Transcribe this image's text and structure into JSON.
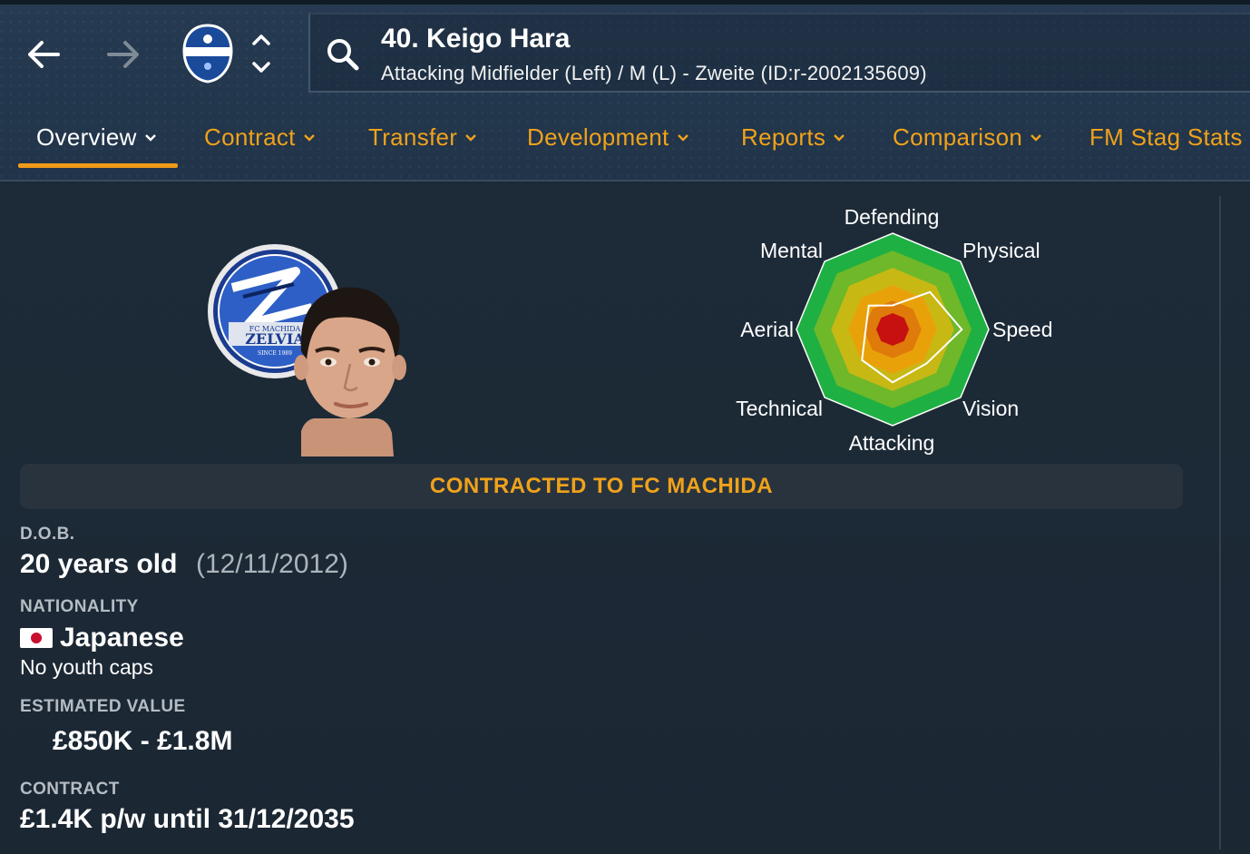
{
  "header": {
    "player_title": "40. Keigo Hara",
    "player_subtitle": "Attacking Midfielder (Left) / M (L) - Zweite (ID:r-2002135609)",
    "back_icon": "arrow-left-icon",
    "forward_icon": "arrow-right-icon",
    "search_icon": "search-icon"
  },
  "tabs": [
    {
      "label": "Overview",
      "active": true,
      "dropdown": true
    },
    {
      "label": "Contract",
      "active": false,
      "dropdown": true
    },
    {
      "label": "Transfer",
      "active": false,
      "dropdown": true
    },
    {
      "label": "Development",
      "active": false,
      "dropdown": true
    },
    {
      "label": "Reports",
      "active": false,
      "dropdown": true
    },
    {
      "label": "Comparison",
      "active": false,
      "dropdown": true
    },
    {
      "label": "FM Stag Stats",
      "active": false,
      "dropdown": false
    }
  ],
  "club_crest": {
    "lines": [
      "FC MACHIDA",
      "ZELVIA",
      "SINCE 1989"
    ]
  },
  "radar": {
    "axes": [
      "Defending",
      "Physical",
      "Speed",
      "Vision",
      "Attacking",
      "Technical",
      "Aerial",
      "Mental"
    ],
    "player_values": [
      0.25,
      0.55,
      0.72,
      0.5,
      0.55,
      0.45,
      0.28,
      0.35
    ]
  },
  "contract_banner": "CONTRACTED TO FC MACHIDA",
  "details": {
    "dob_label": "D.O.B.",
    "age": "20 years old",
    "dob_date": "(12/11/2012)",
    "nationality_label": "NATIONALITY",
    "nationality": "Japanese",
    "youth_caps": "No youth caps",
    "value_label": "ESTIMATED VALUE",
    "value": "£850K - £1.8M",
    "contract_label": "CONTRACT",
    "contract": "£1.4K p/w until 31/12/2035"
  },
  "colors": {
    "accent": "#f0a21a",
    "background": "#1c2a37",
    "radar_rings": [
      "#1fb043",
      "#6eb82a",
      "#c8b814",
      "#e9a10a",
      "#de7b0a",
      "#c71010"
    ]
  }
}
